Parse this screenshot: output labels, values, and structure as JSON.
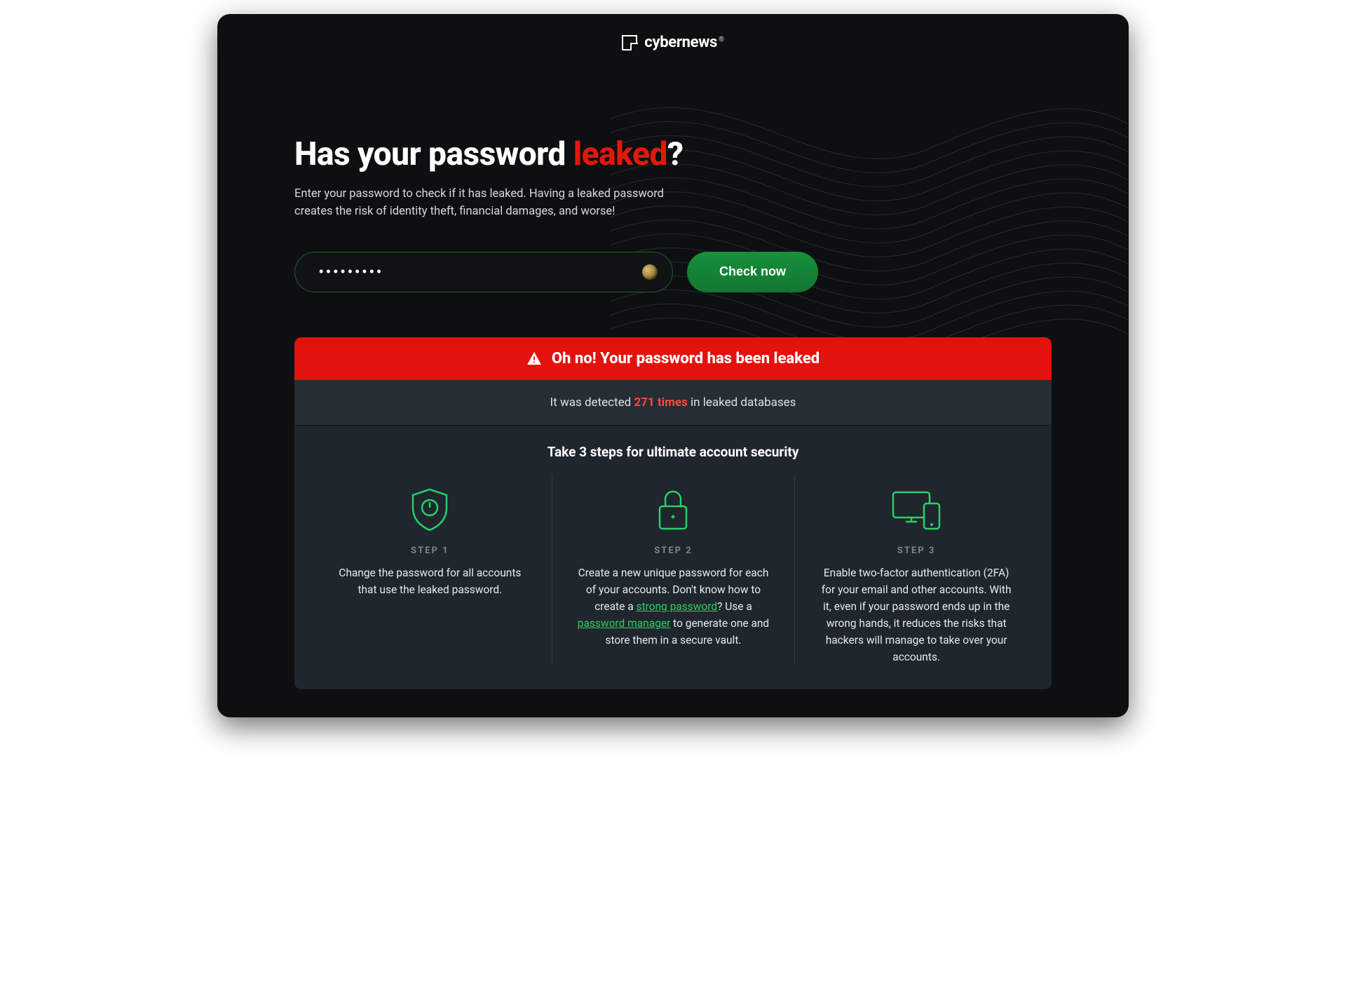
{
  "brand": "cybernews",
  "hero": {
    "title_prefix": "Has your password ",
    "title_accent": "leaked",
    "title_suffix": "?",
    "subtitle": "Enter your password to check if it has leaked. Having a leaked password creates the risk of identity theft, financial damages, and worse!"
  },
  "input": {
    "value": "•••••••••",
    "placeholder": ""
  },
  "button": {
    "label": "Check now"
  },
  "alert": {
    "text": "Oh no! Your password has been leaked"
  },
  "detected": {
    "prefix": "It was detected ",
    "count": "271 times",
    "suffix": " in leaked databases"
  },
  "steps_heading": "Take 3 steps for ultimate account security",
  "steps": [
    {
      "label": "STEP 1",
      "text_pre": "Change the password for all accounts that use the leaked password.",
      "link1": "",
      "text_mid": "",
      "link2": "",
      "text_post": ""
    },
    {
      "label": "STEP 2",
      "text_pre": "Create a new unique password for each of your accounts. Don't know how to create a ",
      "link1": "strong password",
      "text_mid": "? Use a ",
      "link2": "password manager",
      "text_post": " to generate one and store them in a secure vault."
    },
    {
      "label": "STEP 3",
      "text_pre": "Enable two-factor authentication (2FA) for your email and other accounts. With it, even if your password ends up in the wrong hands, it reduces the risks that hackers will manage to take over your accounts.",
      "link1": "",
      "text_mid": "",
      "link2": "",
      "text_post": ""
    }
  ],
  "colors": {
    "accent_red": "#e3120d",
    "accent_green": "#2ecf63",
    "button_green": "#17903c"
  }
}
